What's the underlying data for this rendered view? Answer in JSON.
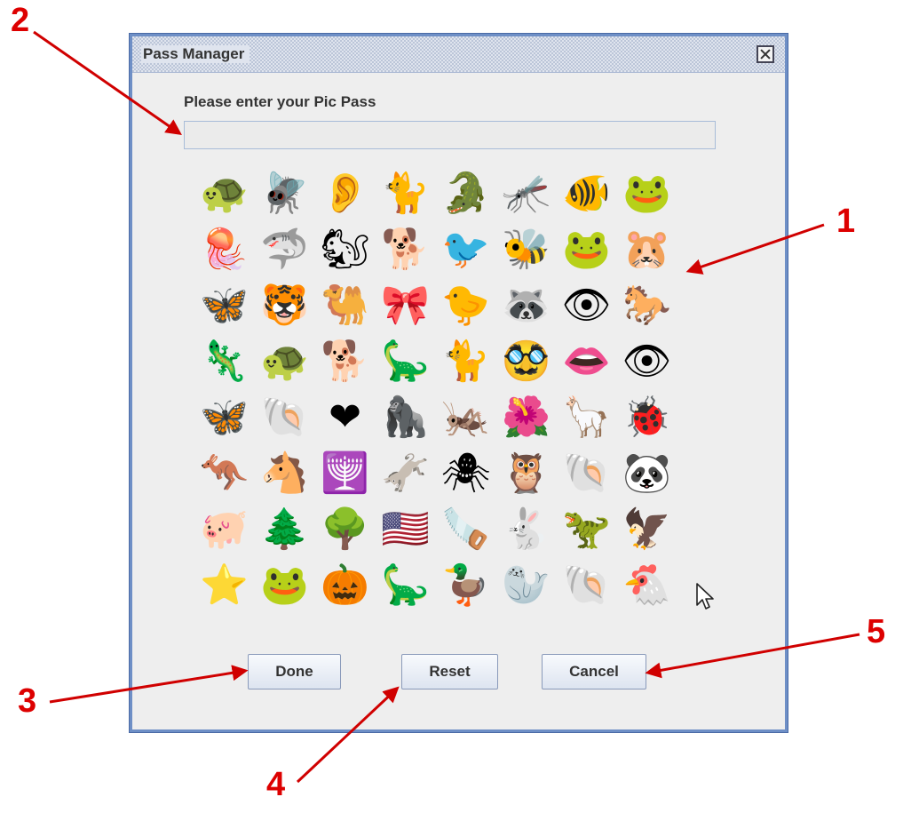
{
  "window": {
    "title": "Pass Manager"
  },
  "prompt": "Please enter your Pic Pass",
  "pass_input": {
    "value": ""
  },
  "buttons": {
    "done": "Done",
    "reset": "Reset",
    "cancel": "Cancel"
  },
  "pictures": [
    [
      [
        "turtle-icon",
        "🐢"
      ],
      [
        "dragonfly-icon",
        "🪰"
      ],
      [
        "ear-icon",
        "👂"
      ],
      [
        "cat-icon",
        "🐈"
      ],
      [
        "crocodile-icon",
        "🐊"
      ],
      [
        "insect-icon",
        "🦟"
      ],
      [
        "angelfish-icon",
        "🐠"
      ],
      [
        "frog-icon",
        "🐸"
      ]
    ],
    [
      [
        "jellyfish-icon",
        "🪼"
      ],
      [
        "shark-icon",
        "🦈"
      ],
      [
        "squirrel-icon",
        "🐿"
      ],
      [
        "dog-icon",
        "🐕"
      ],
      [
        "bird-icon",
        "🐦"
      ],
      [
        "bee-icon",
        "🐝"
      ],
      [
        "toad-icon",
        "🐸"
      ],
      [
        "hamster-icon",
        "🐹"
      ]
    ],
    [
      [
        "butterfly-icon",
        "🦋"
      ],
      [
        "tiger-icon",
        "🐯"
      ],
      [
        "camel-icon",
        "🐫"
      ],
      [
        "bowtie-icon",
        "🎀"
      ],
      [
        "chick-icon",
        "🐤"
      ],
      [
        "raccoon-icon",
        "🦝"
      ],
      [
        "eye-icon",
        "👁"
      ],
      [
        "horse-icon",
        "🐎"
      ]
    ],
    [
      [
        "lizard-icon",
        "🦎"
      ],
      [
        "tortoise-icon",
        "🐢"
      ],
      [
        "afghan-hound-icon",
        "🐕"
      ],
      [
        "dinosaur-icon",
        "🦕"
      ],
      [
        "tabby-cat-icon",
        "🐈"
      ],
      [
        "disguise-glasses-icon",
        "🥸"
      ],
      [
        "lips-icon",
        "👄"
      ],
      [
        "eye-brow-icon",
        "👁"
      ]
    ],
    [
      [
        "pink-butterfly-icon",
        "🦋"
      ],
      [
        "seashell-icon",
        "🐚"
      ],
      [
        "heart-icon",
        "❤"
      ],
      [
        "gorilla-icon",
        "🦍"
      ],
      [
        "grasshopper-icon",
        "🦗"
      ],
      [
        "flower-icon",
        "🌺"
      ],
      [
        "llama-icon",
        "🦙"
      ],
      [
        "ladybug-icon",
        "🐞"
      ]
    ],
    [
      [
        "kangaroo-icon",
        "🦘"
      ],
      [
        "horse-head-icon",
        "🐴"
      ],
      [
        "menorah-icon",
        "🕎"
      ],
      [
        "donkey-icon",
        "🫏"
      ],
      [
        "spider-icon",
        "🕷"
      ],
      [
        "owl-icon",
        "🦉"
      ],
      [
        "clam-icon",
        "🐚"
      ],
      [
        "panda-icon",
        "🐼"
      ]
    ],
    [
      [
        "pig-icon",
        "🐖"
      ],
      [
        "pine-tree-icon",
        "🌲"
      ],
      [
        "tree-icon",
        "🌳"
      ],
      [
        "flag-icon",
        "🇺🇸"
      ],
      [
        "saw-icon",
        "🪚"
      ],
      [
        "rabbit-icon",
        "🐇"
      ],
      [
        "pterodactyl-icon",
        "🦖"
      ],
      [
        "eagle-icon",
        "🦅"
      ]
    ],
    [
      [
        "star-icon",
        "⭐"
      ],
      [
        "green-frog-icon",
        "🐸"
      ],
      [
        "pumpkin-icon",
        "🎃"
      ],
      [
        "stegosaurus-icon",
        "🦕"
      ],
      [
        "duck-icon",
        "🦆"
      ],
      [
        "sea-lion-icon",
        "🦭"
      ],
      [
        "sand-dollar-icon",
        "🐚"
      ],
      [
        "hen-icon",
        "🐔"
      ]
    ]
  ],
  "callouts": {
    "c1": "1",
    "c2": "2",
    "c3": "3",
    "c4": "4",
    "c5": "5"
  },
  "colors": {
    "accent": "#6e8fc6",
    "callout": "#dd0000"
  }
}
